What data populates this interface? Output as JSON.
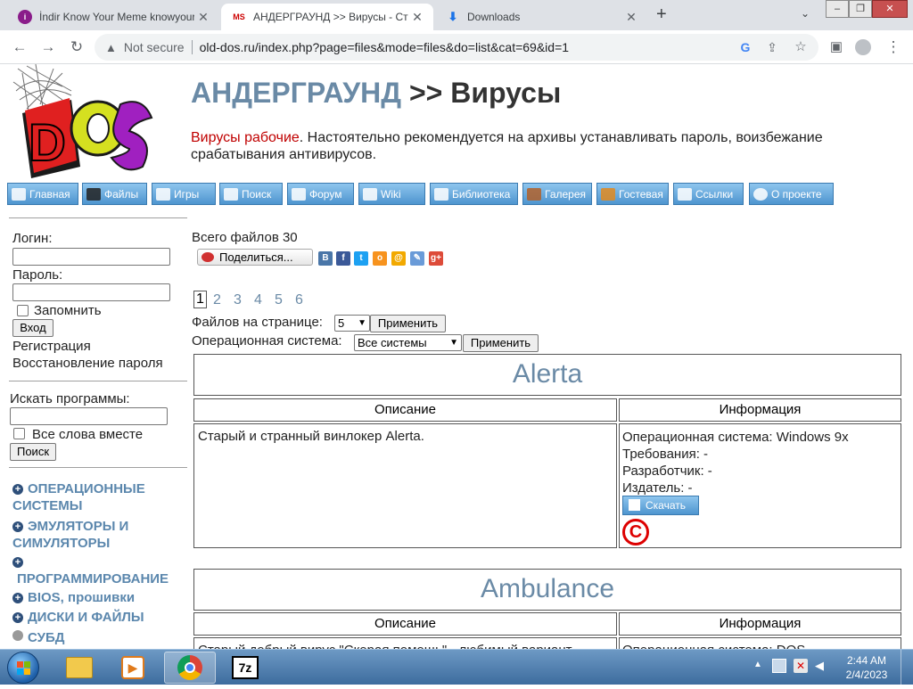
{
  "browser": {
    "tabs": [
      {
        "title": "İndir Know Your Meme knowyour",
        "active": false
      },
      {
        "title": "АНДЕРГРАУНД >> Вирусы - Ста",
        "active": true
      },
      {
        "title": "Downloads",
        "active": false
      }
    ],
    "new_tab": "+",
    "security": "Not secure",
    "url": "old-dos.ru/index.php?page=files&mode=files&do=list&cat=69&id=1"
  },
  "header": {
    "logo_text": "DOS",
    "title_link": "АНДЕРГРАУНД",
    "title_sep": ">>",
    "title_current": "Вирусы",
    "desc_red": "Вирусы рабочие",
    "desc_text": ". Настоятельно рекомендуется на архивы устанавливать пароль, воизбежание срабатывания антивирусов."
  },
  "nav": [
    "Главная",
    "Файлы",
    "Игры",
    "Поиск",
    "Форум",
    "Wiki",
    "Библиотека",
    "Галерея",
    "Гостевая",
    "Ссылки",
    "О проекте"
  ],
  "login": {
    "login_label": "Логин:",
    "password_label": "Пароль:",
    "remember": "Запомнить",
    "submit": "Вход",
    "register": "Регистрация",
    "restore": "Восстановление пароля"
  },
  "search": {
    "label": "Искать программы:",
    "all_words": "Все слова вместе",
    "submit": "Поиск"
  },
  "categories": {
    "c1a": "ОПЕРАЦИОННЫЕ",
    "c1b": "СИСТЕМЫ",
    "c2a": "ЭМУЛЯТОРЫ И",
    "c2b": "СИМУЛЯТОРЫ",
    "c3": "ПРОГРАММИРОВАНИЕ",
    "c4": "BIOS, прошивки",
    "c5": "ДИСКИ И ФАЙЛЫ",
    "c6": "СУБД"
  },
  "main": {
    "total": "Всего файлов 30",
    "share": "Поделиться...",
    "pages": [
      "1",
      "2",
      "3",
      "4",
      "5",
      "6"
    ],
    "per_page_label": "Файлов на странице:",
    "per_page_value": "5",
    "apply": "Применить",
    "os_label": "Операционная система:",
    "os_value": "Все системы",
    "col_desc": "Описание",
    "col_info": "Информация",
    "files": [
      {
        "name": "Alerta",
        "description": "Старый и странный винлокер Alerta.",
        "os": "Операционная система: Windows 9x",
        "req": "Требования: -",
        "dev": "Разработчик: -",
        "pub": "Издатель: -",
        "download": "Скачать"
      },
      {
        "name": "Ambulance",
        "description": "Старый добрый вирус \"Скорая помощь\" - любимый вариант",
        "os": "Операционная система: DOS"
      }
    ]
  },
  "taskbar": {
    "time": "2:44 AM",
    "date": "2/4/2023"
  }
}
